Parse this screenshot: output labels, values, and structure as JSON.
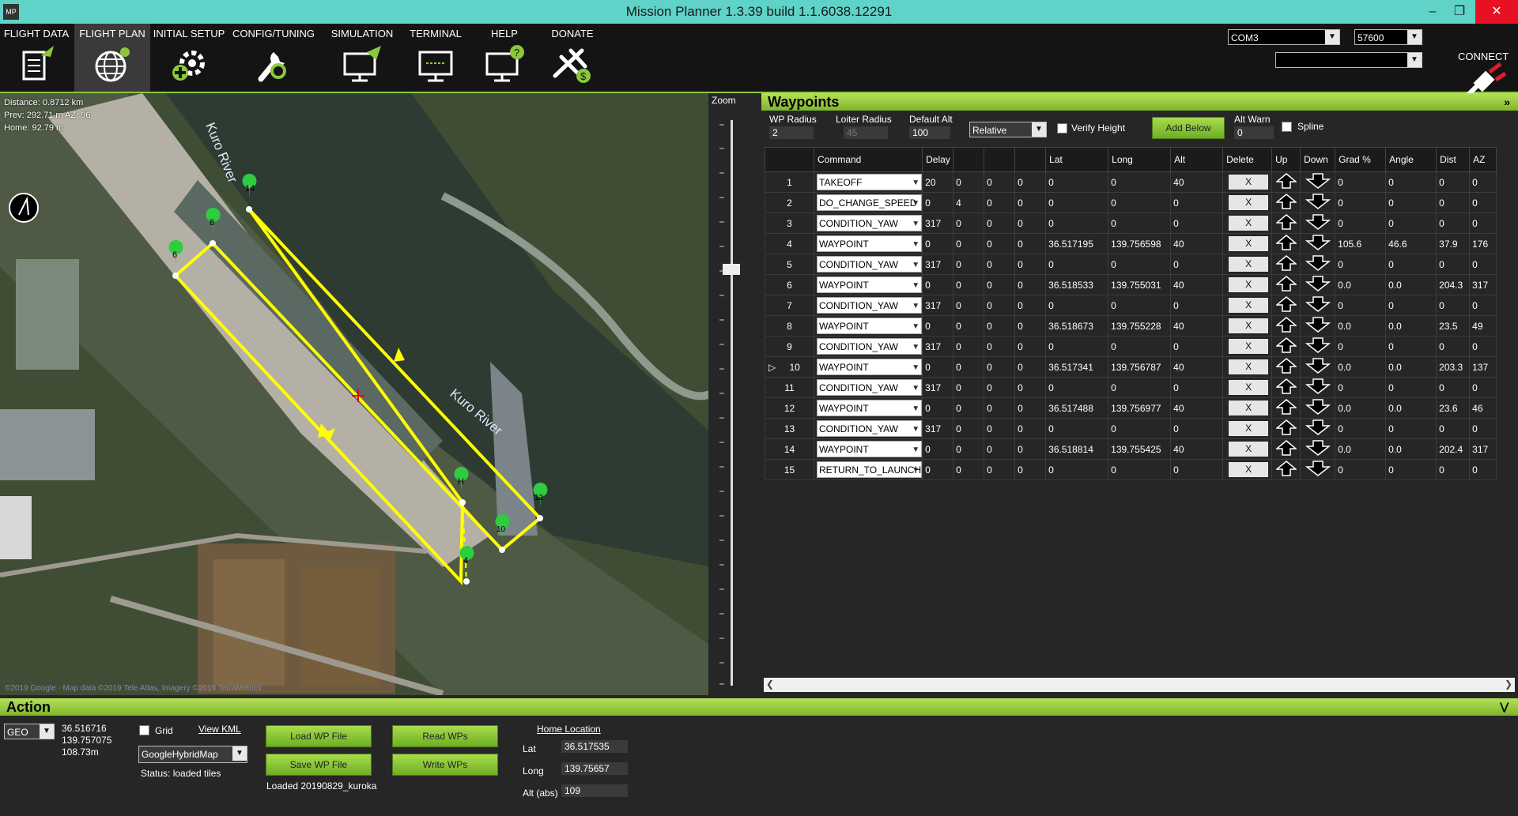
{
  "window": {
    "title": "Mission Planner 1.3.39 build 1.1.6038.12291",
    "logo": "MP"
  },
  "menu": [
    {
      "label": "FLIGHT DATA",
      "icon": "flight-data-icon"
    },
    {
      "label": "FLIGHT PLAN",
      "icon": "flight-plan-globe-icon",
      "active": true
    },
    {
      "label": "INITIAL SETUP",
      "icon": "initial-setup-gear-icon"
    },
    {
      "label": "CONFIG/TUNING",
      "icon": "config-wrench-icon"
    },
    {
      "label": "SIMULATION",
      "icon": "simulation-monitor-icon"
    },
    {
      "label": "TERMINAL",
      "icon": "terminal-monitor-icon"
    },
    {
      "label": "HELP",
      "icon": "help-monitor-icon"
    },
    {
      "label": "DONATE",
      "icon": "donate-plane-icon"
    }
  ],
  "connection": {
    "port": "COM3",
    "baud": "57600",
    "profile": "",
    "connect_label": "CONNECT"
  },
  "map": {
    "info": [
      "Distance: 0.8712 km",
      "Prev: 292.71 m AZ: 96",
      "Home: 92.79 m"
    ],
    "river_labels": [
      "Kuro River",
      "Kuro River"
    ],
    "copyright": "©2019 Google - Map data ©2019 Tele Atlas, Imagery ©2019 TerraMetrics",
    "markers": [
      "14",
      "8",
      "6",
      "H",
      "12",
      "10",
      "4"
    ]
  },
  "zoom": {
    "label": "Zoom"
  },
  "waypoints": {
    "title": "Waypoints",
    "wp_radius_label": "WP Radius",
    "wp_radius": "2",
    "loiter_radius_label": "Loiter Radius",
    "loiter_radius": "45",
    "default_alt_label": "Default Alt",
    "default_alt": "100",
    "alt_mode": "Relative",
    "verify_height_label": "Verify Height",
    "add_below_label": "Add Below",
    "alt_warn_label": "Alt Warn",
    "alt_warn": "0",
    "spline_label": "Spline",
    "columns": [
      "",
      "Command",
      "Delay",
      "",
      "",
      "",
      "Lat",
      "Long",
      "Alt",
      "Delete",
      "Up",
      "Down",
      "Grad %",
      "Angle",
      "Dist",
      "AZ"
    ],
    "rows": [
      {
        "n": "1",
        "cmd": "TAKEOFF",
        "p1": "20",
        "p2": "0",
        "p3": "0",
        "p4": "0",
        "lat": "0",
        "lng": "0",
        "alt": "40",
        "grad": "0",
        "angle": "0",
        "dist": "0",
        "az": "0"
      },
      {
        "n": "2",
        "cmd": "DO_CHANGE_SPEED",
        "p1": "0",
        "p2": "4",
        "p3": "0",
        "p4": "0",
        "lat": "0",
        "lng": "0",
        "alt": "0",
        "grad": "0",
        "angle": "0",
        "dist": "0",
        "az": "0"
      },
      {
        "n": "3",
        "cmd": "CONDITION_YAW",
        "p1": "317",
        "p2": "0",
        "p3": "0",
        "p4": "0",
        "lat": "0",
        "lng": "0",
        "alt": "0",
        "grad": "0",
        "angle": "0",
        "dist": "0",
        "az": "0"
      },
      {
        "n": "4",
        "cmd": "WAYPOINT",
        "p1": "0",
        "p2": "0",
        "p3": "0",
        "p4": "0",
        "lat": "36.517195",
        "lng": "139.756598",
        "alt": "40",
        "grad": "105.6",
        "angle": "46.6",
        "dist": "37.9",
        "az": "176"
      },
      {
        "n": "5",
        "cmd": "CONDITION_YAW",
        "p1": "317",
        "p2": "0",
        "p3": "0",
        "p4": "0",
        "lat": "0",
        "lng": "0",
        "alt": "0",
        "grad": "0",
        "angle": "0",
        "dist": "0",
        "az": "0"
      },
      {
        "n": "6",
        "cmd": "WAYPOINT",
        "p1": "0",
        "p2": "0",
        "p3": "0",
        "p4": "0",
        "lat": "36.518533",
        "lng": "139.755031",
        "alt": "40",
        "grad": "0.0",
        "angle": "0.0",
        "dist": "204.3",
        "az": "317"
      },
      {
        "n": "7",
        "cmd": "CONDITION_YAW",
        "p1": "317",
        "p2": "0",
        "p3": "0",
        "p4": "0",
        "lat": "0",
        "lng": "0",
        "alt": "0",
        "grad": "0",
        "angle": "0",
        "dist": "0",
        "az": "0"
      },
      {
        "n": "8",
        "cmd": "WAYPOINT",
        "p1": "0",
        "p2": "0",
        "p3": "0",
        "p4": "0",
        "lat": "36.518673",
        "lng": "139.755228",
        "alt": "40",
        "grad": "0.0",
        "angle": "0.0",
        "dist": "23.5",
        "az": "49"
      },
      {
        "n": "9",
        "cmd": "CONDITION_YAW",
        "p1": "317",
        "p2": "0",
        "p3": "0",
        "p4": "0",
        "lat": "0",
        "lng": "0",
        "alt": "0",
        "grad": "0",
        "angle": "0",
        "dist": "0",
        "az": "0"
      },
      {
        "n": "10",
        "cmd": "WAYPOINT",
        "p1": "0",
        "p2": "0",
        "p3": "0",
        "p4": "0",
        "lat": "36.517341",
        "lng": "139.756787",
        "alt": "40",
        "grad": "0.0",
        "angle": "0.0",
        "dist": "203.3",
        "az": "137",
        "current": true
      },
      {
        "n": "11",
        "cmd": "CONDITION_YAW",
        "p1": "317",
        "p2": "0",
        "p3": "0",
        "p4": "0",
        "lat": "0",
        "lng": "0",
        "alt": "0",
        "grad": "0",
        "angle": "0",
        "dist": "0",
        "az": "0"
      },
      {
        "n": "12",
        "cmd": "WAYPOINT",
        "p1": "0",
        "p2": "0",
        "p3": "0",
        "p4": "0",
        "lat": "36.517488",
        "lng": "139.756977",
        "alt": "40",
        "grad": "0.0",
        "angle": "0.0",
        "dist": "23.6",
        "az": "46"
      },
      {
        "n": "13",
        "cmd": "CONDITION_YAW",
        "p1": "317",
        "p2": "0",
        "p3": "0",
        "p4": "0",
        "lat": "0",
        "lng": "0",
        "alt": "0",
        "grad": "0",
        "angle": "0",
        "dist": "0",
        "az": "0"
      },
      {
        "n": "14",
        "cmd": "WAYPOINT",
        "p1": "0",
        "p2": "0",
        "p3": "0",
        "p4": "0",
        "lat": "36.518814",
        "lng": "139.755425",
        "alt": "40",
        "grad": "0.0",
        "angle": "0.0",
        "dist": "202.4",
        "az": "317"
      },
      {
        "n": "15",
        "cmd": "RETURN_TO_LAUNCH",
        "p1": "0",
        "p2": "0",
        "p3": "0",
        "p4": "0",
        "lat": "0",
        "lng": "0",
        "alt": "0",
        "grad": "0",
        "angle": "0",
        "dist": "0",
        "az": "0"
      }
    ],
    "delete_label": "X"
  },
  "action": {
    "title": "Action",
    "coord_mode": "GEO",
    "cursor_lat": "36.516716",
    "cursor_lng": "139.757075",
    "cursor_alt": "108.73m",
    "grid_label": "Grid",
    "view_kml_label": "View KML",
    "map_type": "GoogleHybridMap",
    "status": "Status: loaded tiles",
    "load_wp_label": "Load WP File",
    "save_wp_label": "Save WP File",
    "read_wps_label": "Read WPs",
    "write_wps_label": "Write WPs",
    "loaded_file": "Loaded 20190829_kuroka",
    "home_location_label": "Home Location",
    "home_lat_label": "Lat",
    "home_lat": "36.517535",
    "home_long_label": "Long",
    "home_long": "139.75657",
    "home_alt_label": "Alt (abs)",
    "home_alt": "109"
  },
  "colors": {
    "accent_green": "#8cc63f",
    "path_yellow": "#ffff00",
    "titlebar": "#5fd3c8"
  }
}
